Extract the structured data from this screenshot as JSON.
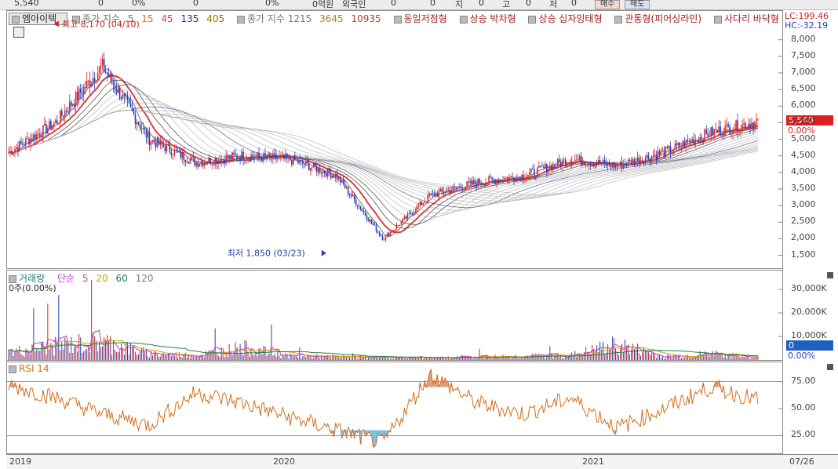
{
  "topbar": {
    "cells": [
      "5,540",
      "0",
      "0%",
      "0",
      "0%",
      "0억원",
      "외국인",
      "0",
      "0",
      "지",
      "0",
      "고",
      "0",
      "저",
      "0"
    ],
    "buy_label": "매수",
    "sell_label": "매도"
  },
  "price_panel": {
    "legend": {
      "name": "엠아이텍",
      "ma_label": "종가 지수",
      "ma_periods": [
        "5",
        "15",
        "45",
        "135",
        "405"
      ],
      "ma_colors": [
        "#e07020",
        "#d04040",
        "#303090",
        "#a07000"
      ],
      "long_label": "종가 지수 1215",
      "long_periods": [
        "3645",
        "10935"
      ],
      "long_colors": [
        "#b08020",
        "#b04040"
      ],
      "patterns": [
        "동일저점형",
        "상승 박차형",
        "상승 십자잉태형",
        "관통형(피어싱라인)",
        "사다리 바닥형"
      ]
    },
    "lc": "LC:199.46",
    "hc": "HC:-32.19",
    "last_price": "5,540",
    "last_change": "0.00%",
    "high_note": "최고 8,170 (04/10)",
    "low_note": "최저 1,850 (03/23)",
    "y_ticks": [
      "8,000",
      "7,500",
      "7,000",
      "6,500",
      "6,000",
      "5,500",
      "5,000",
      "4,500",
      "4,000",
      "3,500",
      "3,000",
      "2,500",
      "2,000",
      "1,500"
    ]
  },
  "volume_panel": {
    "legend": {
      "title": "거래량",
      "ma_label": "단순",
      "periods": [
        "5",
        "20",
        "60",
        "120"
      ],
      "colors": [
        "#c040c0",
        "#d0a000",
        "#208040",
        "#808080"
      ]
    },
    "sub": "0주(0.00%)",
    "y_ticks": [
      "30,000K",
      "20,000K",
      "10,000K"
    ],
    "last_value": "0",
    "last_change": "0.00%"
  },
  "rsi_panel": {
    "label": "RSI 14",
    "y_ticks": [
      "75.00",
      "50.00",
      "25.00"
    ]
  },
  "x_axis": [
    "2019",
    "2020",
    "2021",
    "07/26"
  ],
  "colors": {
    "up": "#e02020",
    "down": "#2040c0",
    "rsi": "#d07020",
    "rsi_over": "#e0a080",
    "rsi_under": "#80c0e0"
  },
  "chart_data": [
    {
      "type": "candlestick",
      "title": "엠아이텍",
      "x": [
        "2019-01",
        "2019-03",
        "2019-04",
        "2019-06",
        "2019-08",
        "2019-10",
        "2019-12",
        "2020-02",
        "2020-03",
        "2020-05",
        "2020-07",
        "2020-09",
        "2020-11",
        "2021-01",
        "2021-03",
        "2021-05",
        "2021-07"
      ],
      "close": [
        4600,
        5500,
        7200,
        5000,
        4300,
        4500,
        4400,
        3900,
        2000,
        3300,
        3700,
        3900,
        4400,
        4200,
        4600,
        5200,
        5540
      ],
      "high_marker": {
        "value": 8170,
        "date": "04/10"
      },
      "low_marker": {
        "value": 1850,
        "date": "03/23"
      },
      "ylim": [
        1300,
        8300
      ]
    },
    {
      "type": "bar",
      "title": "거래량",
      "x": [
        "2019-01",
        "2019-03",
        "2019-04",
        "2019-06",
        "2019-08",
        "2019-10",
        "2019-12",
        "2020-02",
        "2020-03",
        "2020-05",
        "2020-07",
        "2020-09",
        "2020-11",
        "2021-01",
        "2021-03",
        "2021-05",
        "2021-07"
      ],
      "values": [
        5000,
        9000,
        12000,
        4000,
        3000,
        8000,
        2500,
        2000,
        1500,
        1500,
        2000,
        2500,
        3000,
        10000,
        2000,
        4000,
        1500
      ],
      "ylim": [
        0,
        34000
      ]
    },
    {
      "type": "line",
      "title": "RSI 14",
      "x": [
        "2019-01",
        "2019-03",
        "2019-04",
        "2019-06",
        "2019-08",
        "2019-10",
        "2019-12",
        "2020-02",
        "2020-03",
        "2020-05",
        "2020-07",
        "2020-09",
        "2020-11",
        "2021-01",
        "2021-03",
        "2021-05",
        "2021-07"
      ],
      "values": [
        72,
        60,
        45,
        35,
        65,
        55,
        42,
        30,
        18,
        82,
        55,
        45,
        60,
        32,
        50,
        70,
        58
      ],
      "ylim": [
        10,
        90
      ]
    }
  ]
}
